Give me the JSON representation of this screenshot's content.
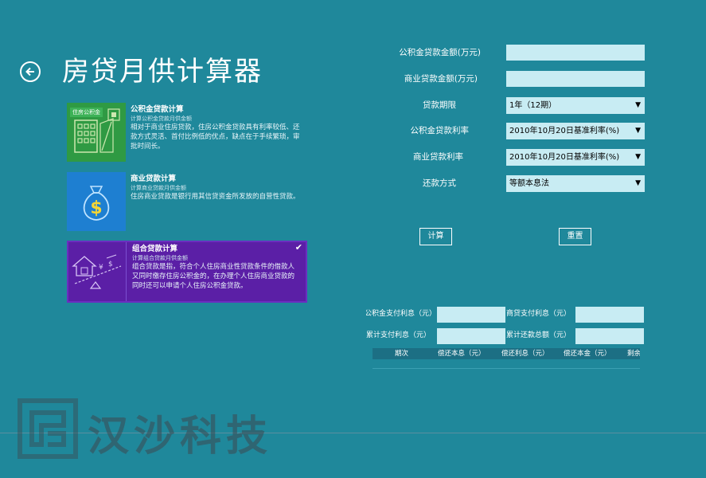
{
  "header": {
    "title": "房贷月供计算器"
  },
  "cards": [
    {
      "title": "公积金贷款计算",
      "subtitle": "计算公积金贷款月供金额",
      "desc": "相对于商业住房贷款，住房公积金贷款具有利率较低、还款方式灵活、首付比例低的优点，缺点在于手续繁琐，审批时间长。",
      "tile_label": "住房公积金",
      "tile_color": "#2f9a43"
    },
    {
      "title": "商业贷款计算",
      "subtitle": "计算商业贷款月供金额",
      "desc": "住房商业贷款是银行用其信贷资金所发放的自营性贷款。",
      "tile_color": "#1e7fd1"
    },
    {
      "title": "组合贷款计算",
      "subtitle": "计算组合贷款月供金额",
      "desc": "组合贷款是指，符合个人住房商业性贷款条件的借款人又同时缴存住房公积金的，在办理个人住房商业贷款的同时还可以申请个人住房公积金贷款。",
      "tile_color": "#5b1fa6",
      "selected": true
    }
  ],
  "form": {
    "fund_amount_label": "公积金贷款金额(万元)",
    "fund_amount_value": "",
    "commercial_amount_label": "商业贷款金额(万元)",
    "commercial_amount_value": "",
    "term_label": "贷款期限",
    "term_value": "1年（12期）",
    "fund_rate_label": "公积金贷款利率",
    "fund_rate_value": "2010年10月20日基准利率(%)",
    "commercial_rate_label": "商业贷款利率",
    "commercial_rate_value": "2010年10月20日基准利率(%)",
    "method_label": "还款方式",
    "method_value": "等额本息法",
    "calc_label": "计算",
    "reset_label": "重置"
  },
  "results": {
    "fund_interest_label": "公积金支付利息（元）",
    "commercial_interest_label": "商贷支付利息（元）",
    "total_interest_label": "累计支付利息（元）",
    "total_repay_label": "累计还款总额（元）"
  },
  "table": {
    "columns": [
      "期次",
      "偿还本息（元）",
      "偿还利息（元）",
      "偿还本金（元）",
      "剩余"
    ]
  },
  "watermark": {
    "text": "汉沙科技"
  },
  "colors": {
    "background": "#1f889b",
    "input": "#c8ecf3",
    "selected_card": "#5b1fa6"
  }
}
